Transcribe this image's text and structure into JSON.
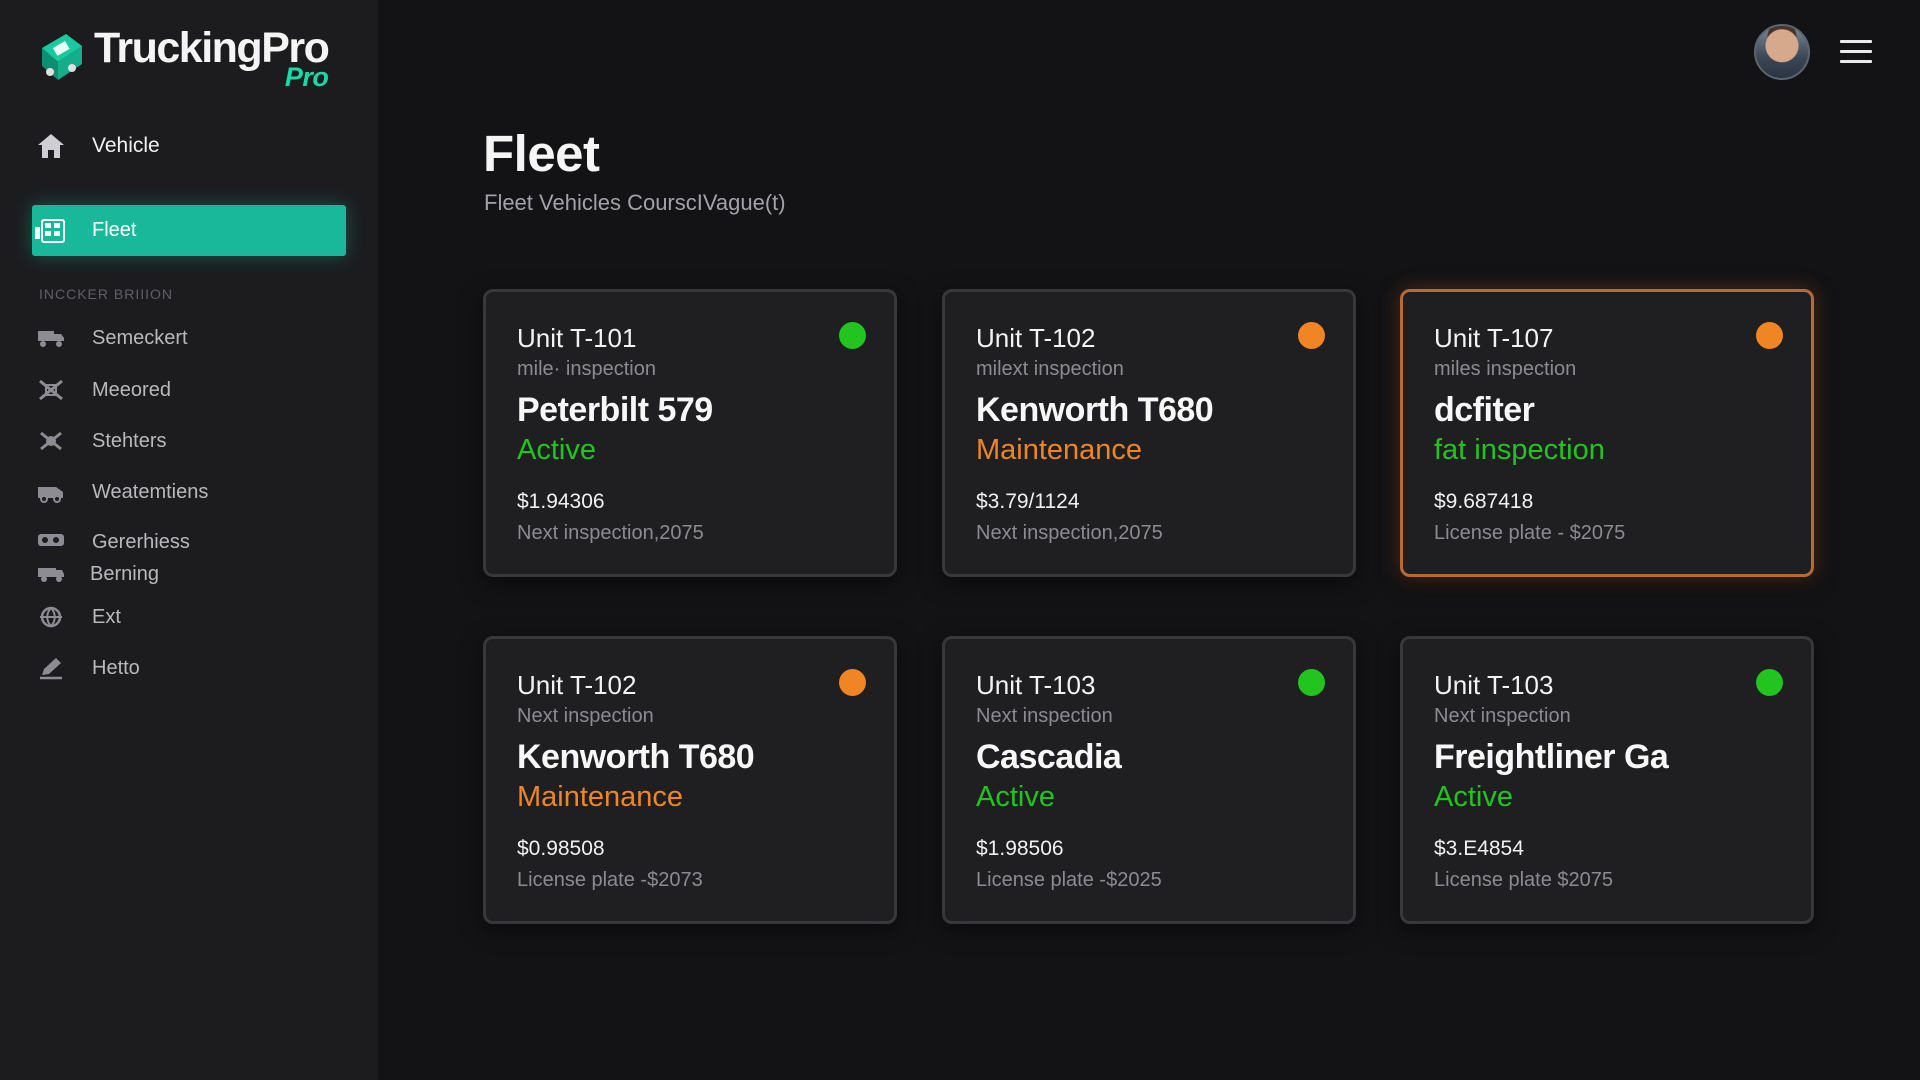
{
  "app": {
    "name": "TruckingPro",
    "badge": "Pro"
  },
  "colors": {
    "accent": "#1ab89a",
    "active": "#22c41f",
    "maintenance": "#f08524"
  },
  "nav": {
    "top_item": {
      "label": "Vehicle",
      "icon": "home-icon"
    },
    "active_item": {
      "label": "Fleet",
      "icon": "fleet-icon"
    },
    "section_header": "INCCKER BRIIION",
    "items": [
      {
        "label": "Semeckert",
        "icon": "truck-icon"
      },
      {
        "label": "Meeored",
        "icon": "tools-icon"
      },
      {
        "label": "Stehters",
        "icon": "wrench-icon"
      },
      {
        "label": "Weatemtiens",
        "icon": "van-icon"
      },
      {
        "label": "Gererhiess",
        "sub": "Berning",
        "icon": "cargo-icon"
      },
      {
        "label": "Ext",
        "icon": "globe-icon"
      },
      {
        "label": "Hetto",
        "icon": "edit-icon"
      }
    ]
  },
  "header": {
    "avatar": "user-avatar",
    "menu_icon": "hamburger-icon"
  },
  "page": {
    "title": "Fleet",
    "subtitle": "Fleet Vehicles CourscIVague(t)"
  },
  "cards": [
    {
      "unit": "Unit T-101",
      "sub": "mile· inspection",
      "model": "Peterbilt 579",
      "status": "Active",
      "status_color": "#22c41f",
      "dot": "#22c41f",
      "price": "$1.94306",
      "footer": "Next inspection,2075",
      "highlight": false
    },
    {
      "unit": "Unit T-102",
      "sub": "milext inspection",
      "model": "Kenworth T680",
      "status": "Maintenance",
      "status_color": "#f08524",
      "dot": "#f08524",
      "price": "$3.79/1124",
      "footer": "Next inspection,2075",
      "highlight": false
    },
    {
      "unit": "Unit T-107",
      "sub": "miles inspection",
      "model": "dcfiter",
      "status": "fat inspection",
      "status_color": "#22c41f",
      "dot": "#f08524",
      "price": "$9.687418",
      "footer": "License plate ‑ $2075",
      "highlight": true
    },
    {
      "unit": "Unit T-102",
      "sub": "Next inspection",
      "model": "Kenworth T680",
      "status": "Maintenance",
      "status_color": "#f08524",
      "dot": "#f08524",
      "price": "$0.98508",
      "footer": "License plate ‑$2073",
      "highlight": false
    },
    {
      "unit": "Unit T-103",
      "sub": "Next inspection",
      "model": "Cascadia",
      "status": "Active",
      "status_color": "#22c41f",
      "dot": "#22c41f",
      "price": "$1.98506",
      "footer": "License plate ‑$2025",
      "highlight": false
    },
    {
      "unit": "Unit T-103",
      "sub": "Next inspection",
      "model": "Freightliner Ga",
      "status": "Active",
      "status_color": "#22c41f",
      "dot": "#22c41f",
      "price": "$3.E4854",
      "footer": "License plate $2075",
      "highlight": false
    }
  ]
}
